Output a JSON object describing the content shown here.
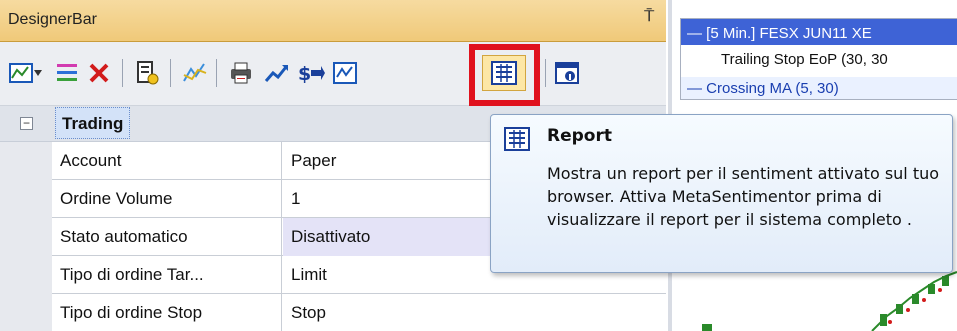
{
  "panel": {
    "title": "DesignerBar",
    "pin_glyph": "⍑"
  },
  "toolbar": {
    "buttons": [
      {
        "name": "chart-add-icon"
      },
      {
        "name": "dropdown-arrow-icon"
      },
      {
        "name": "list-lines-icon"
      },
      {
        "name": "delete-x-icon"
      },
      {
        "name": "strategy-icon"
      },
      {
        "name": "indicator-line-icon"
      },
      {
        "name": "print-icon"
      },
      {
        "name": "signal-arrow-icon"
      },
      {
        "name": "money-flow-icon"
      },
      {
        "name": "chart-window-icon"
      },
      {
        "name": "report-icon"
      },
      {
        "name": "info-window-icon"
      }
    ],
    "highlight_color": "#e0121e"
  },
  "group": {
    "toggle": "−",
    "label": "Trading"
  },
  "properties": [
    {
      "name": "Account",
      "value": "Paper"
    },
    {
      "name": "Ordine Volume",
      "value": "1"
    },
    {
      "name": "Stato automatico",
      "value": "Disattivato"
    },
    {
      "name": "Tipo di ordine Tar...",
      "value": "Limit"
    },
    {
      "name": "Tipo di ordine Stop",
      "value": "Stop"
    }
  ],
  "chart": {
    "legend": [
      "— [5 Min.] FESX JUN11   XE",
      "Trailing Stop EoP  (30, 30",
      "— Crossing MA  (5, 30)"
    ]
  },
  "tooltip": {
    "title": "Report",
    "body": "Mostra un report per il sentiment attivato sul tuo browser. Attiva MetaSentimentor prima di visualizzare il report per il sistema completo ."
  },
  "colors": {
    "titlebar": "#f0c979",
    "accent_blue": "#3e63d6",
    "highlight": "#e0121e"
  }
}
